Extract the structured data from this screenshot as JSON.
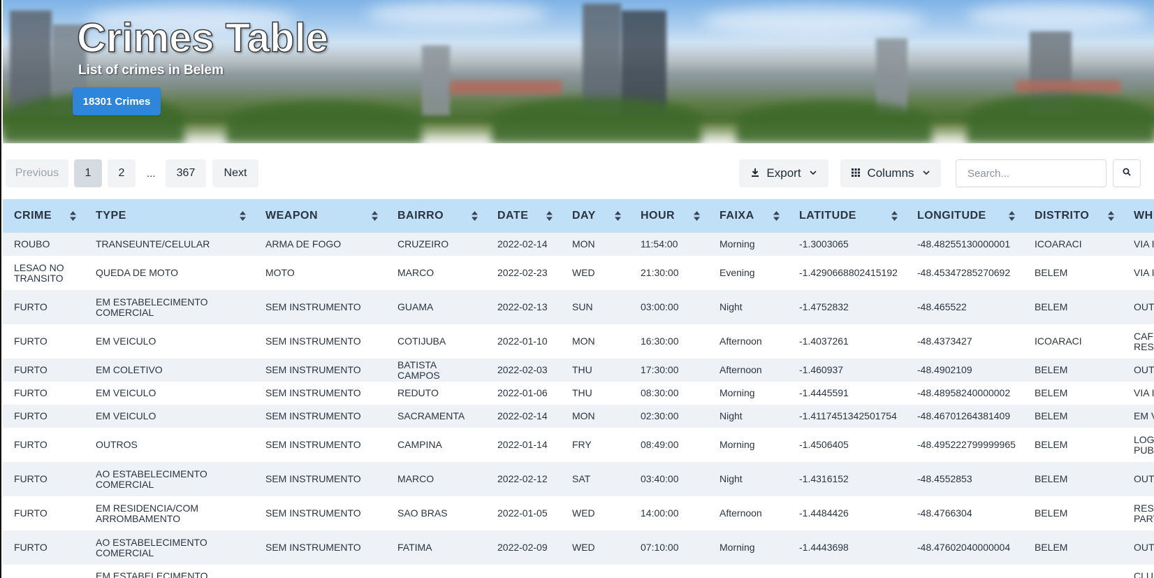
{
  "header": {
    "title": "Crimes Table",
    "subtitle": "List of crimes in Belem",
    "count_badge": "18301 Crimes"
  },
  "pagination": {
    "previous": "Previous",
    "pages": [
      "1",
      "2"
    ],
    "ellipsis": "...",
    "last": "367",
    "next": "Next",
    "active_page": "1"
  },
  "toolbar": {
    "export_label": "Export",
    "columns_label": "Columns",
    "search_placeholder": "Search..."
  },
  "icons": {
    "export": "download-icon",
    "columns": "grid-icon",
    "search": "search-icon",
    "sort": "sort-icon",
    "chevron": "chevron-down-icon"
  },
  "colors": {
    "header_row": "#bfe0f7",
    "badge": "#2d86d9",
    "stripe": "#eef2f6"
  },
  "table": {
    "columns": [
      "CRIME",
      "TYPE",
      "WEAPON",
      "BAIRRO",
      "DATE",
      "DAY",
      "HOUR",
      "FAIXA",
      "LATITUDE",
      "LONGITUDE",
      "DISTRITO",
      "WH"
    ],
    "rows": [
      [
        "ROUBO",
        "TRANSEUNTE/CELULAR",
        "ARMA DE FOGO",
        "CRUZEIRO",
        "2022-02-14",
        "MON",
        "11:54:00",
        "Morning",
        "-1.3003065",
        "-48.48255130000001",
        "ICOARACI",
        "VIA I"
      ],
      [
        "LESAO NO TRANSITO",
        "QUEDA DE MOTO",
        "MOTO",
        "MARCO",
        "2022-02-23",
        "WED",
        "21:30:00",
        "Evening",
        "-1.4290668802415192",
        "-48.45347285270692",
        "BELEM",
        "VIA I"
      ],
      [
        "FURTO",
        "EM ESTABELECIMENTO COMERCIAL",
        "SEM INSTRUMENTO",
        "GUAMA",
        "2022-02-13",
        "SUN",
        "03:00:00",
        "Night",
        "-1.4752832",
        "-48.465522",
        "BELEM",
        "OUT"
      ],
      [
        "FURTO",
        "EM VEICULO",
        "SEM INSTRUMENTO",
        "COTIJUBA",
        "2022-01-10",
        "MON",
        "16:30:00",
        "Afternoon",
        "-1.4037261",
        "-48.4373427",
        "ICOARACI",
        "CAFI REST"
      ],
      [
        "FURTO",
        "EM COLETIVO",
        "SEM INSTRUMENTO",
        "BATISTA CAMPOS",
        "2022-02-03",
        "THU",
        "17:30:00",
        "Afternoon",
        "-1.460937",
        "-48.4902109",
        "BELEM",
        "OUT"
      ],
      [
        "FURTO",
        "EM VEICULO",
        "SEM INSTRUMENTO",
        "REDUTO",
        "2022-01-06",
        "THU",
        "08:30:00",
        "Morning",
        "-1.4445591",
        "-48.48958240000002",
        "BELEM",
        "VIA I"
      ],
      [
        "FURTO",
        "EM VEICULO",
        "SEM INSTRUMENTO",
        "SACRAMENTA",
        "2022-02-14",
        "MON",
        "02:30:00",
        "Night",
        "-1.4117451342501754",
        "-48.46701264381409",
        "BELEM",
        "EM V"
      ],
      [
        "FURTO",
        "OUTROS",
        "SEM INSTRUMENTO",
        "CAMPINA",
        "2022-01-14",
        "FRY",
        "08:49:00",
        "Morning",
        "-1.4506405",
        "-48.495222799999965",
        "BELEM",
        "LOG PUBI"
      ],
      [
        "FURTO",
        "AO ESTABELECIMENTO COMERCIAL",
        "SEM INSTRUMENTO",
        "MARCO",
        "2022-02-12",
        "SAT",
        "03:40:00",
        "Night",
        "-1.4316152",
        "-48.4552853",
        "BELEM",
        "OUT"
      ],
      [
        "FURTO",
        "EM RESIDENCIA/COM ARROMBAMENTO",
        "SEM INSTRUMENTO",
        "SAO BRAS",
        "2022-01-05",
        "WED",
        "14:00:00",
        "Afternoon",
        "-1.4484426",
        "-48.4766304",
        "BELEM",
        "RESI PART"
      ],
      [
        "FURTO",
        "AO ESTABELECIMENTO COMERCIAL",
        "SEM INSTRUMENTO",
        "FATIMA",
        "2022-02-09",
        "WED",
        "07:10:00",
        "Morning",
        "-1.4443698",
        "-48.47602040000004",
        "BELEM",
        "OUT"
      ],
      [
        "",
        "EM ESTABELECIMENTO",
        "",
        "",
        "",
        "",
        "",
        "",
        "",
        "",
        "",
        "CLUI"
      ]
    ]
  }
}
